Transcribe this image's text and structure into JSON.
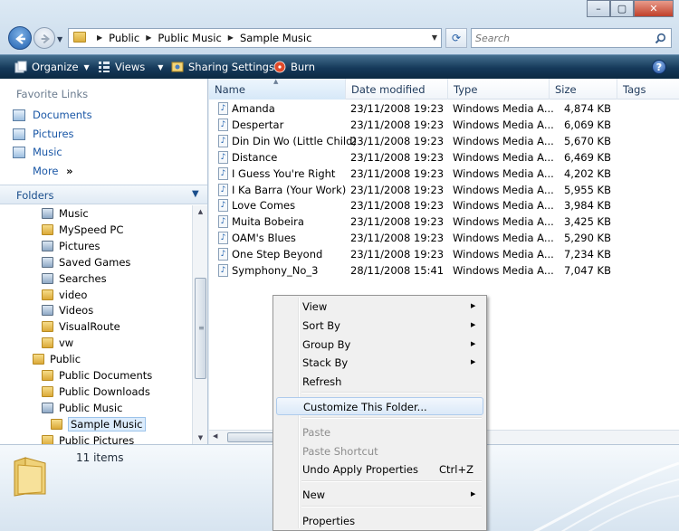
{
  "address_bar": {
    "crumbs": [
      "Public",
      "Public Music",
      "Sample Music"
    ],
    "search_placeholder": "Search"
  },
  "window_buttons": {
    "minimize": "–",
    "maximize": "▢",
    "close": "✕"
  },
  "command_bar": {
    "organize": "Organize",
    "views": "Views",
    "sharing_settings": "Sharing Settings",
    "burn": "Burn",
    "help": "?"
  },
  "nav_pane": {
    "favorite_links_title": "Favorite Links",
    "favorites": [
      "Documents",
      "Pictures",
      "Music"
    ],
    "more": "More",
    "folders_title": "Folders",
    "tree": [
      {
        "label": "Music",
        "icon": "system-folder"
      },
      {
        "label": "MySpeed PC",
        "icon": "folder"
      },
      {
        "label": "Pictures",
        "icon": "system-folder"
      },
      {
        "label": "Saved Games",
        "icon": "system-folder"
      },
      {
        "label": "Searches",
        "icon": "system-folder"
      },
      {
        "label": "video",
        "icon": "folder"
      },
      {
        "label": "Videos",
        "icon": "system-folder"
      },
      {
        "label": "VisualRoute",
        "icon": "folder"
      },
      {
        "label": "vw",
        "icon": "folder"
      },
      {
        "label": "Public",
        "icon": "folder"
      },
      {
        "label": "Public Documents",
        "icon": "folder"
      },
      {
        "label": "Public Downloads",
        "icon": "folder"
      },
      {
        "label": "Public Music",
        "icon": "system-folder"
      },
      {
        "label": "Sample Music",
        "icon": "folder",
        "selected": true
      },
      {
        "label": "Public Pictures",
        "icon": "folder"
      }
    ]
  },
  "file_list": {
    "columns": [
      "Name",
      "Date modified",
      "Type",
      "Size",
      "Tags"
    ],
    "rows": [
      {
        "name": "Amanda",
        "date": "23/11/2008 19:23",
        "type": "Windows Media A...",
        "size": "4,874 KB"
      },
      {
        "name": "Despertar",
        "date": "23/11/2008 19:23",
        "type": "Windows Media A...",
        "size": "6,069 KB"
      },
      {
        "name": "Din Din Wo (Little Child)",
        "date": "23/11/2008 19:23",
        "type": "Windows Media A...",
        "size": "5,670 KB"
      },
      {
        "name": "Distance",
        "date": "23/11/2008 19:23",
        "type": "Windows Media A...",
        "size": "6,469 KB"
      },
      {
        "name": "I Guess You're Right",
        "date": "23/11/2008 19:23",
        "type": "Windows Media A...",
        "size": "4,202 KB"
      },
      {
        "name": "I Ka Barra (Your Work)",
        "date": "23/11/2008 19:23",
        "type": "Windows Media A...",
        "size": "5,955 KB"
      },
      {
        "name": "Love Comes",
        "date": "23/11/2008 19:23",
        "type": "Windows Media A...",
        "size": "3,984 KB"
      },
      {
        "name": "Muita Bobeira",
        "date": "23/11/2008 19:23",
        "type": "Windows Media A...",
        "size": "3,425 KB"
      },
      {
        "name": "OAM's Blues",
        "date": "23/11/2008 19:23",
        "type": "Windows Media A...",
        "size": "5,290 KB"
      },
      {
        "name": "One Step Beyond",
        "date": "23/11/2008 19:23",
        "type": "Windows Media A...",
        "size": "7,234 KB"
      },
      {
        "name": "Symphony_No_3",
        "date": "28/11/2008 15:41",
        "type": "Windows Media A...",
        "size": "7,047 KB"
      }
    ]
  },
  "details_pane": {
    "item_count": "11 items"
  },
  "context_menu": {
    "items": [
      {
        "label": "View",
        "submenu": true,
        "enabled": true
      },
      {
        "label": "Sort By",
        "submenu": true,
        "enabled": true
      },
      {
        "label": "Group By",
        "submenu": true,
        "enabled": true
      },
      {
        "label": "Stack By",
        "submenu": true,
        "enabled": true
      },
      {
        "label": "Refresh",
        "enabled": true
      },
      {
        "separator": true
      },
      {
        "label": "Customize This Folder...",
        "enabled": true,
        "highlighted": true
      },
      {
        "separator": true
      },
      {
        "label": "Paste",
        "enabled": false
      },
      {
        "label": "Paste Shortcut",
        "enabled": false
      },
      {
        "label": "Undo Apply Properties",
        "shortcut": "Ctrl+Z",
        "enabled": true
      },
      {
        "separator": true
      },
      {
        "label": "New",
        "submenu": true,
        "enabled": true
      },
      {
        "separator": true
      },
      {
        "label": "Properties",
        "enabled": true
      }
    ]
  },
  "colors": {
    "command_bar": "#15395a",
    "link_blue": "#1a57a6",
    "selection": "#dcecfc",
    "menu_bg": "#f0f0f0"
  }
}
